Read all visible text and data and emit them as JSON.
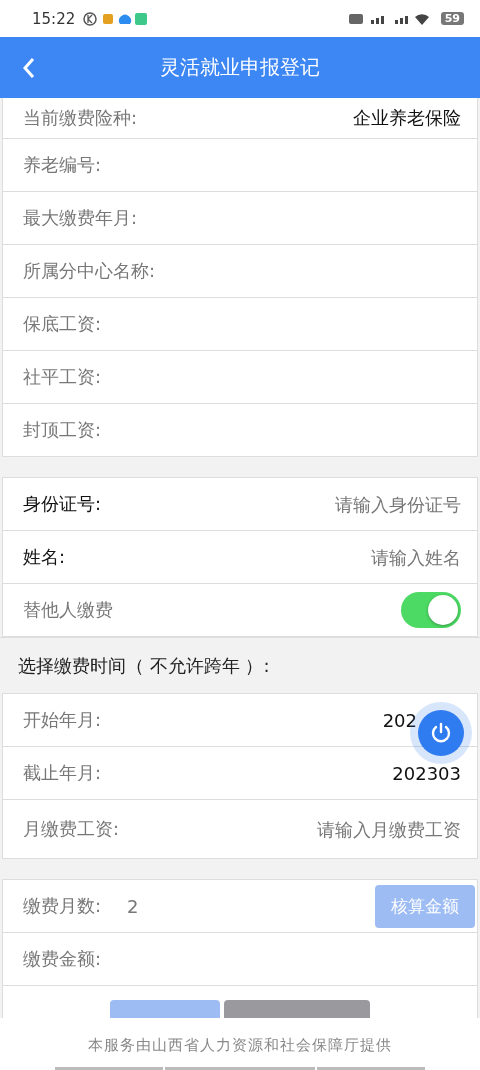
{
  "status_bar": {
    "time": "15:22",
    "battery": "59"
  },
  "header": {
    "title": "灵活就业申报登记"
  },
  "info_section": {
    "rows": [
      {
        "label": "当前缴费险种:",
        "value": "企业养老保险"
      },
      {
        "label": "养老编号:"
      },
      {
        "label": "最大缴费年月:"
      },
      {
        "label": "所属分中心名称:"
      },
      {
        "label": "保底工资:"
      },
      {
        "label": "社平工资:"
      },
      {
        "label": "封顶工资:"
      }
    ]
  },
  "payer_section": {
    "rows": [
      {
        "kind": "input",
        "label": "身份证号:",
        "emphasized": true,
        "placeholder": "请输入身份证号"
      },
      {
        "kind": "input",
        "label": "姓名:",
        "emphasized": true,
        "placeholder": "请输入姓名"
      },
      {
        "kind": "toggle",
        "label": "替他人缴费",
        "emphasized": false,
        "on": true
      }
    ]
  },
  "period_heading": "选择缴费时间（ 不允许跨年 ）:",
  "period_section": {
    "rows": [
      {
        "kind": "text",
        "label": "开始年月:",
        "value": "202"
      },
      {
        "kind": "text",
        "label": "截止年月:",
        "value": "202303"
      },
      {
        "kind": "input",
        "label": "月缴费工资:",
        "placeholder": "请输入月缴费工资"
      }
    ]
  },
  "amount_section": {
    "months_label": "缴费月数:",
    "months_value": "2",
    "calc_button": "核算金额",
    "amount_label": "缴费金额:",
    "buttons": [
      {
        "enabled": false
      },
      {
        "enabled": false
      }
    ]
  },
  "footer": {
    "text": "本服务由山西省人力资源和社会保障厅提供"
  }
}
